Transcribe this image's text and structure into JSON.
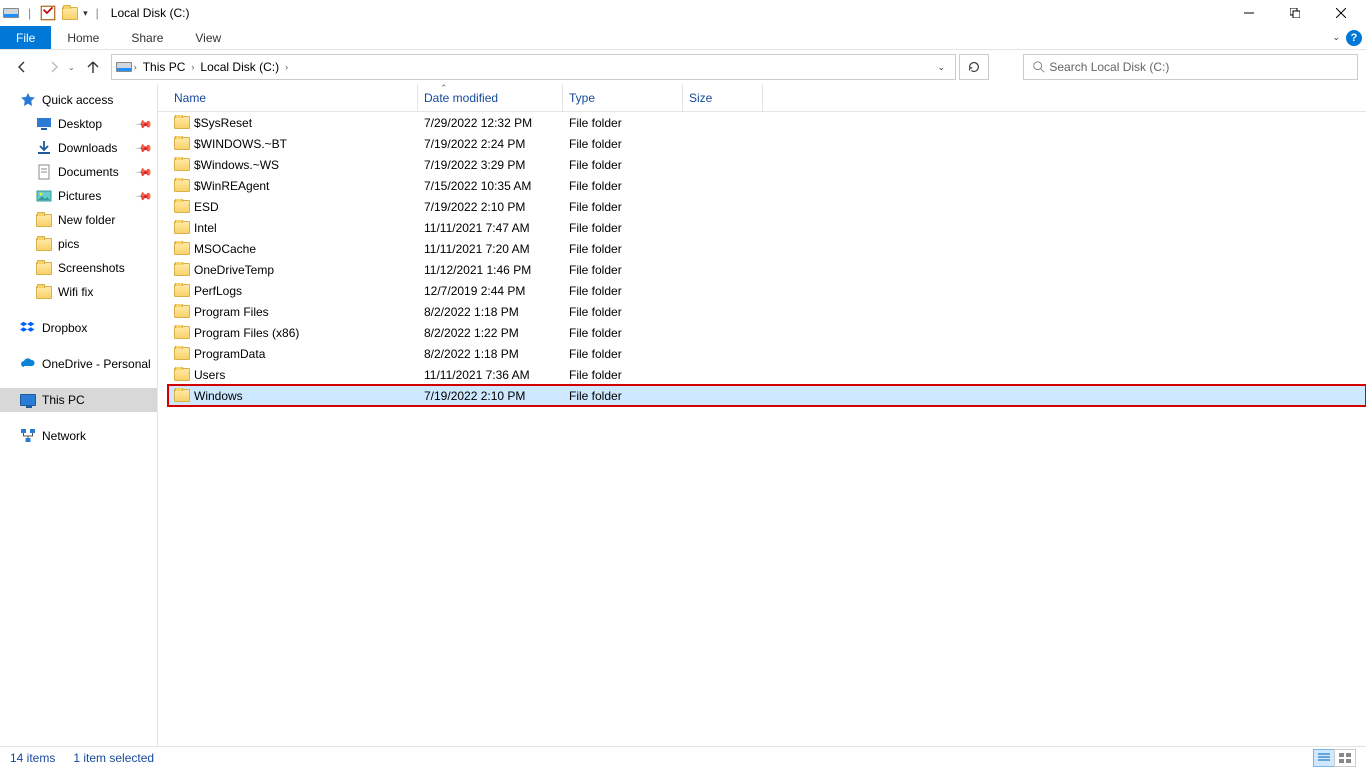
{
  "window_title": "Local Disk (C:)",
  "ribbon_tabs": {
    "file": "File",
    "home": "Home",
    "share": "Share",
    "view": "View"
  },
  "breadcrumb": {
    "pc": "This PC",
    "loc": "Local Disk (C:)"
  },
  "search_placeholder": "Search Local Disk (C:)",
  "columns": {
    "name": "Name",
    "date": "Date modified",
    "type": "Type",
    "size": "Size"
  },
  "nav": {
    "quick_access": "Quick access",
    "desktop": "Desktop",
    "downloads": "Downloads",
    "documents": "Documents",
    "pictures": "Pictures",
    "new_folder": "New folder",
    "pics": "pics",
    "screenshots": "Screenshots",
    "wifi_fix": "Wifi fix",
    "dropbox": "Dropbox",
    "onedrive": "OneDrive - Personal",
    "this_pc": "This PC",
    "network": "Network"
  },
  "rows": [
    {
      "name": "$SysReset",
      "date": "7/29/2022 12:32 PM",
      "type": "File folder"
    },
    {
      "name": "$WINDOWS.~BT",
      "date": "7/19/2022 2:24 PM",
      "type": "File folder"
    },
    {
      "name": "$Windows.~WS",
      "date": "7/19/2022 3:29 PM",
      "type": "File folder"
    },
    {
      "name": "$WinREAgent",
      "date": "7/15/2022 10:35 AM",
      "type": "File folder"
    },
    {
      "name": "ESD",
      "date": "7/19/2022 2:10 PM",
      "type": "File folder"
    },
    {
      "name": "Intel",
      "date": "11/11/2021 7:47 AM",
      "type": "File folder"
    },
    {
      "name": "MSOCache",
      "date": "11/11/2021 7:20 AM",
      "type": "File folder"
    },
    {
      "name": "OneDriveTemp",
      "date": "11/12/2021 1:46 PM",
      "type": "File folder"
    },
    {
      "name": "PerfLogs",
      "date": "12/7/2019 2:44 PM",
      "type": "File folder"
    },
    {
      "name": "Program Files",
      "date": "8/2/2022 1:18 PM",
      "type": "File folder"
    },
    {
      "name": "Program Files (x86)",
      "date": "8/2/2022 1:22 PM",
      "type": "File folder"
    },
    {
      "name": "ProgramData",
      "date": "8/2/2022 1:18 PM",
      "type": "File folder"
    },
    {
      "name": "Users",
      "date": "11/11/2021 7:36 AM",
      "type": "File folder"
    },
    {
      "name": "Windows",
      "date": "7/19/2022 2:10 PM",
      "type": "File folder",
      "selected": true,
      "highlighted": true
    }
  ],
  "status": {
    "count": "14 items",
    "selected": "1 item selected"
  }
}
